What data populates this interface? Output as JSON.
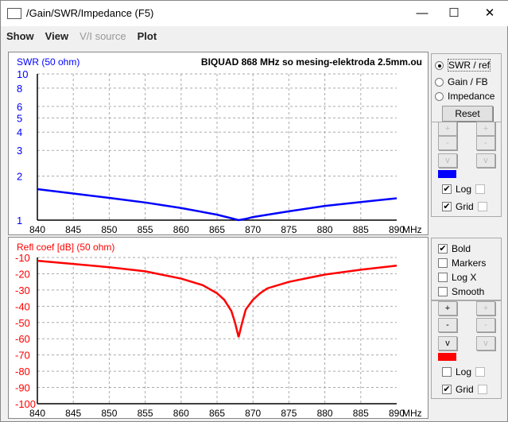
{
  "window": {
    "title": "/Gain/SWR/Impedance (F5)",
    "minimize": "—",
    "maximize": "☐",
    "close": "✕"
  },
  "menu": [
    "Show",
    "View",
    "V/I source",
    "Plot"
  ],
  "top_panel": {
    "mode_options": [
      "SWR / ref",
      "Gain / FB",
      "Impedance"
    ],
    "selected_mode": "SWR / ref",
    "reset_label": "Reset",
    "btn_plus": "+",
    "btn_minus": "-",
    "btn_v": "v",
    "color": "#0000ff",
    "log_label": "Log",
    "log_checked": true,
    "grid_label": "Grid",
    "grid_checked": true
  },
  "bottom_panel": {
    "options": [
      {
        "label": "Bold",
        "checked": true
      },
      {
        "label": "Markers",
        "checked": false
      },
      {
        "label": "Log X",
        "checked": false
      },
      {
        "label": "Smooth",
        "checked": false
      }
    ],
    "btn_plus": "+",
    "btn_minus": "-",
    "btn_v": "v",
    "color": "#ff0000",
    "log_label": "Log",
    "log_checked": false,
    "grid_label": "Grid",
    "grid_checked": true
  },
  "chart_data": [
    {
      "type": "line",
      "title": "BIQUAD 868 MHz so mesing-elektroda 2.5mm.ou",
      "ylabel": "SWR (50 ohm)",
      "xlabel": "MHz",
      "yscale": "log",
      "ylim": [
        1,
        10
      ],
      "xlim": [
        840,
        890
      ],
      "xticks": [
        "840",
        "845",
        "850",
        "855",
        "860",
        "865",
        "870",
        "875",
        "880",
        "885",
        "890"
      ],
      "yticks": [
        "1",
        "2",
        "3",
        "4",
        "5",
        "6",
        "8",
        "10"
      ],
      "ytick_values": [
        1,
        2,
        3,
        4,
        5,
        6,
        8,
        10
      ],
      "grid": true,
      "color": "#0000ff",
      "x": [
        840,
        845,
        850,
        855,
        860,
        865,
        867,
        868,
        869,
        870,
        875,
        880,
        885,
        890
      ],
      "y": [
        1.63,
        1.52,
        1.42,
        1.32,
        1.21,
        1.09,
        1.03,
        1.0,
        1.02,
        1.05,
        1.15,
        1.25,
        1.33,
        1.41
      ]
    },
    {
      "type": "line",
      "ylabel": "Refl coef [dB] (50 ohm)",
      "xlabel": "MHz",
      "ylim": [
        -100,
        -10
      ],
      "xlim": [
        840,
        890
      ],
      "xticks": [
        "840",
        "845",
        "850",
        "855",
        "860",
        "865",
        "870",
        "875",
        "880",
        "885",
        "890"
      ],
      "yticks": [
        "-10",
        "-20",
        "-30",
        "-40",
        "-50",
        "-60",
        "-70",
        "-80",
        "-90",
        "-100"
      ],
      "grid": true,
      "color": "#ff0000",
      "x": [
        840,
        845,
        850,
        855,
        860,
        863,
        865,
        866,
        867,
        867.5,
        868,
        868.5,
        869,
        870,
        871,
        872,
        875,
        880,
        885,
        890
      ],
      "y": [
        -12,
        -14,
        -16,
        -18.5,
        -23,
        -27,
        -32,
        -36,
        -43,
        -50,
        -59,
        -50,
        -42,
        -36,
        -32,
        -29,
        -25,
        -20.5,
        -17.5,
        -15
      ]
    }
  ]
}
